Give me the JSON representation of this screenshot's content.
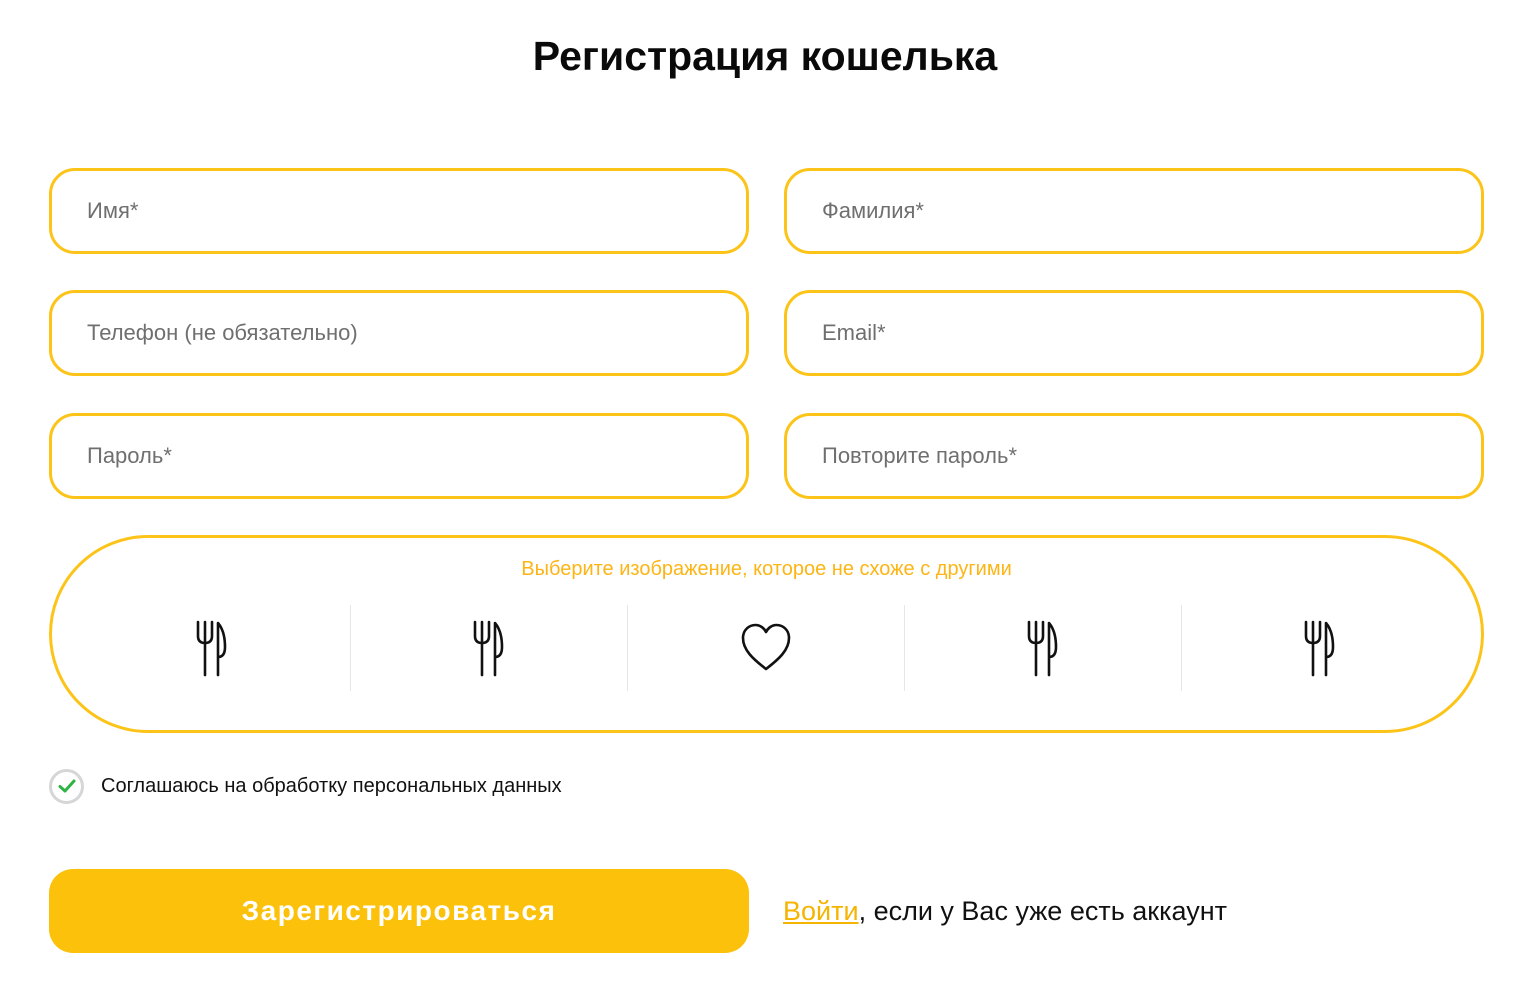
{
  "page": {
    "title": "Регистрация кошелька"
  },
  "form": {
    "first_name": {
      "placeholder": "Имя*",
      "value": ""
    },
    "last_name": {
      "placeholder": "Фамилия*",
      "value": ""
    },
    "phone": {
      "placeholder": "Телефон (не обязательно)",
      "value": ""
    },
    "email": {
      "placeholder": "Email*",
      "value": ""
    },
    "password": {
      "placeholder": "Пароль*",
      "value": ""
    },
    "password_repeat": {
      "placeholder": "Повторите пароль*",
      "value": ""
    }
  },
  "captcha": {
    "prompt": "Выберите изображение, которое не схоже с другими",
    "options": [
      {
        "icon": "fork-knife-icon"
      },
      {
        "icon": "fork-knife-icon"
      },
      {
        "icon": "heart-icon"
      },
      {
        "icon": "fork-knife-icon"
      },
      {
        "icon": "fork-knife-icon"
      }
    ]
  },
  "consent": {
    "label": "Соглашаюсь на обработку персональных данных",
    "checked": true
  },
  "actions": {
    "submit_label": "Зарегистрироваться",
    "login_link": "Войти",
    "login_suffix": ", если у Вас уже есть аккаунт"
  },
  "colors": {
    "accent": "#fcc419",
    "button": "#fcc10a",
    "link": "#f5b400",
    "check": "#2fb344"
  }
}
